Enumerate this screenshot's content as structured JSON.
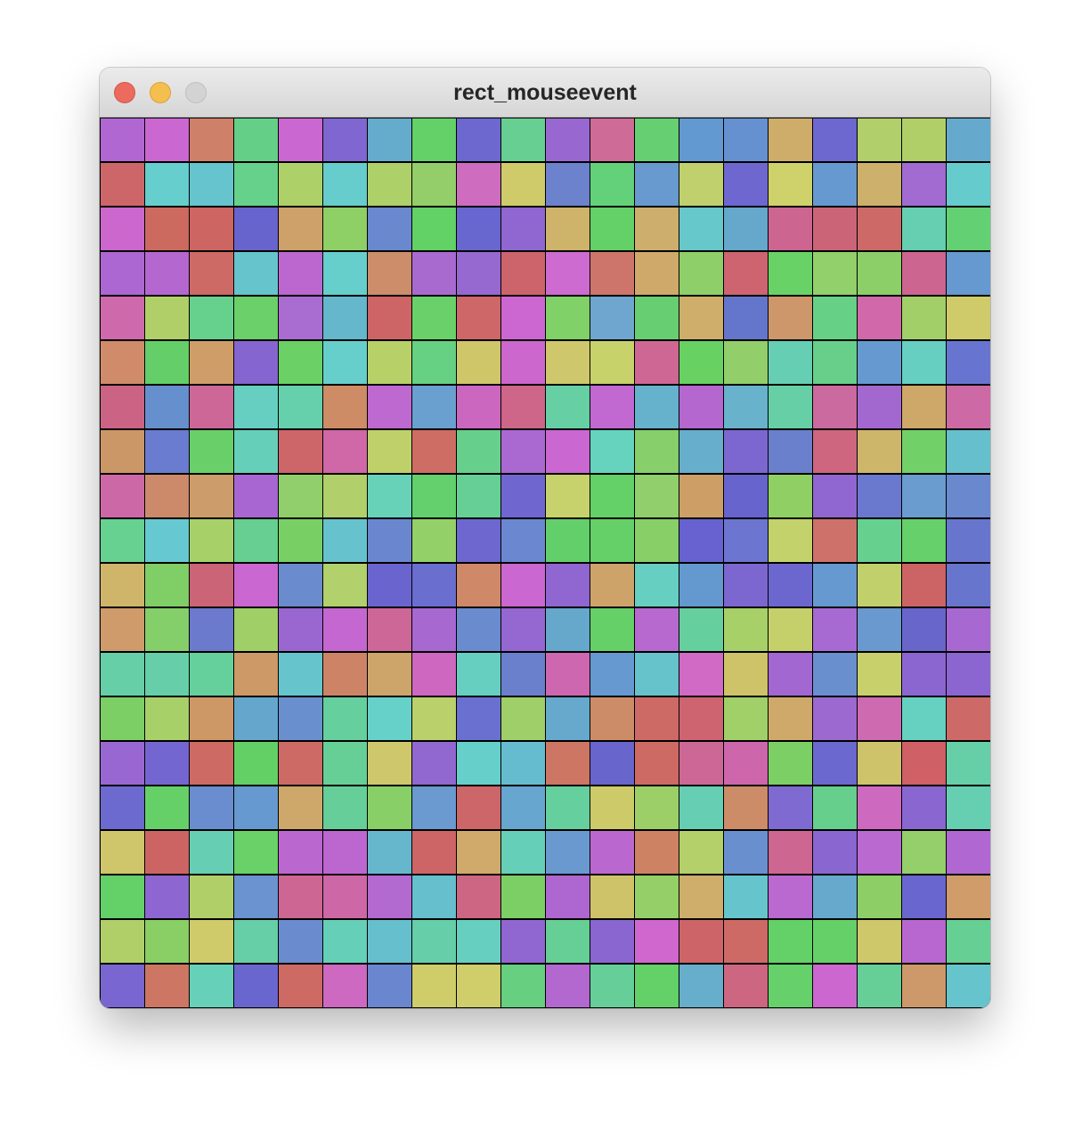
{
  "window": {
    "title": "rect_mouseevent"
  },
  "traffic_lights": {
    "close": {
      "icon": "close-icon",
      "color": "#ed6a5e"
    },
    "minimize": {
      "icon": "minimize-icon",
      "color": "#f5bf4f"
    },
    "zoom": {
      "icon": "zoom-icon",
      "color": "#d3d3d3"
    }
  },
  "grid": {
    "rows": 20,
    "cols": 20,
    "border_color": "#000000",
    "colors": [
      [
        "#b067d1",
        "#cb67d1",
        "#cf8068",
        "#64d087",
        "#cb67d1",
        "#8066d0",
        "#64abcc",
        "#64d068",
        "#6d67d0",
        "#67cf91",
        "#9967d0",
        "#ce6b97",
        "#66cf71",
        "#6299d1",
        "#6591d0",
        "#cead6b",
        "#6d67d0",
        "#b1cf6a",
        "#b1cf68",
        "#65a9cc"
      ],
      [
        "#cd6668",
        "#66cecc",
        "#66c4ce",
        "#66d18b",
        "#aed068",
        "#66cccc",
        "#aed068",
        "#94ce6a",
        "#ce6cbf",
        "#cfcb6a",
        "#6d82cd",
        "#63d17a",
        "#6899cf",
        "#c0d06c",
        "#6f67d0",
        "#cfd16a",
        "#6699cf",
        "#cdb06c",
        "#a16bd2",
        "#66cbcc"
      ],
      [
        "#cb67cd",
        "#cd6a5f",
        "#cd6562",
        "#6864cd",
        "#cea06a",
        "#8ecf66",
        "#6988cd",
        "#62d166",
        "#6867cf",
        "#9066d1",
        "#ceb36a",
        "#64d068",
        "#ceae6c",
        "#66c8cb",
        "#66a7cc",
        "#cd6591",
        "#cc6478",
        "#cd6a68",
        "#67cfb1",
        "#63d173"
      ],
      [
        "#ac67d2",
        "#b567d0",
        "#cd6a66",
        "#66c4cc",
        "#bc67d0",
        "#66cfcb",
        "#cd8d6b",
        "#a96ad0",
        "#9669d0",
        "#cd646b",
        "#cd6bd0",
        "#cd756b",
        "#cea96a",
        "#8fcf69",
        "#cd6470",
        "#68d266",
        "#91d06b",
        "#8ccf69",
        "#cd6591",
        "#6699cf"
      ],
      [
        "#ce6aab",
        "#b1cf68",
        "#66d08d",
        "#6bcf6a",
        "#a96cd0",
        "#65b7cc",
        "#cd6466",
        "#6ad16a",
        "#cd6768",
        "#cc67d1",
        "#7fd168",
        "#6fa6cf",
        "#67cf72",
        "#cfae6b",
        "#6476cb",
        "#cd976b",
        "#66d186",
        "#d168a9",
        "#a3cf69",
        "#d0cb6a"
      ],
      [
        "#cf8b6a",
        "#64cf68",
        "#cf9e68",
        "#8565cf",
        "#6bd066",
        "#66cfcc",
        "#b8d068",
        "#66d083",
        "#cfc66a",
        "#cb67cd",
        "#cfc76b",
        "#c7d26b",
        "#cf6795",
        "#67d162",
        "#92ce6a",
        "#66cfb3",
        "#67cf89",
        "#6699cf",
        "#66cfc2",
        "#6875d0"
      ],
      [
        "#cb6384",
        "#6690cd",
        "#cd6797",
        "#66cfc2",
        "#66cfac",
        "#ce8c66",
        "#bd69d0",
        "#6aa0d0",
        "#cc67c0",
        "#cd6688",
        "#66d0a4",
        "#c169d0",
        "#66b1cc",
        "#b467cf",
        "#68b2cc",
        "#66cfa5",
        "#cb6a9e",
        "#a368d0",
        "#cda868",
        "#cd6aa5"
      ],
      [
        "#cc9766",
        "#6a7ccf",
        "#69cf68",
        "#66cfb9",
        "#cd6668",
        "#d067a6",
        "#bfd06b",
        "#cd6d64",
        "#67cf8c",
        "#a969d1",
        "#cb67d1",
        "#66d3bf",
        "#86cf6a",
        "#66aecc",
        "#7c67d0",
        "#6a80cd",
        "#ce6680",
        "#cdb66a",
        "#72d068",
        "#66bfcc"
      ],
      [
        "#cd68a6",
        "#cd8a6a",
        "#cc9c6a",
        "#a766d1",
        "#90cf6b",
        "#b1cf6a",
        "#68d2b8",
        "#63d06d",
        "#66cf95",
        "#6f67cf",
        "#c7d26d",
        "#63d068",
        "#90cf6b",
        "#cd9f67",
        "#6764cd",
        "#8fcf64",
        "#9066d0",
        "#6a78cd",
        "#6a9ccf",
        "#6a88cd"
      ],
      [
        "#66d191",
        "#66c9d1",
        "#a8d068",
        "#66cf91",
        "#78cf64",
        "#66c3cd",
        "#6a86cf",
        "#94d068",
        "#6d67cf",
        "#6b87cf",
        "#63cf6a",
        "#66d068",
        "#88cf68",
        "#6762cf",
        "#6c75cf",
        "#c4d26b",
        "#cd716a",
        "#66d18f",
        "#66d06a",
        "#6875cd"
      ],
      [
        "#cfb56a",
        "#80ce66",
        "#cc6478",
        "#cb67d1",
        "#6a8ccf",
        "#b2d06b",
        "#6a64cf",
        "#6a6fcf",
        "#cf8868",
        "#cb67d1",
        "#9066d0",
        "#cea36a",
        "#66cfc1",
        "#6499cf",
        "#7b67cf",
        "#6b67cf",
        "#6699cf",
        "#c2d06b",
        "#cc6466",
        "#6875cd"
      ],
      [
        "#cf9b6a",
        "#85cf6b",
        "#6b7acd",
        "#a0cf67",
        "#9967cf",
        "#c567d0",
        "#cd6797",
        "#a768d0",
        "#6a8ccf",
        "#9567d0",
        "#66a8cc",
        "#65d067",
        "#b769d0",
        "#66cf9e",
        "#a7d068",
        "#c6d06b",
        "#a66ad2",
        "#6a99cf",
        "#6966cb",
        "#a868d1"
      ],
      [
        "#66cfa8",
        "#66cfa9",
        "#66d09d",
        "#cd9967",
        "#66c4cd",
        "#cd8466",
        "#cda56a",
        "#cd67bf",
        "#66cfc0",
        "#6a80cd",
        "#cd67b0",
        "#6699cf",
        "#66c3cc",
        "#d06ac4",
        "#cfc36a",
        "#a267d0",
        "#6a8fcf",
        "#c8d06b",
        "#8c66d0",
        "#8c66d0"
      ],
      [
        "#7bcf64",
        "#a7d068",
        "#cd9766",
        "#65a7cc",
        "#6a8fcf",
        "#66cf9e",
        "#66d1c8",
        "#bad06b",
        "#6a70cf",
        "#9fcf68",
        "#66a9cc",
        "#cd8c68",
        "#cd6a66",
        "#cd6470",
        "#a1cf68",
        "#cea96a",
        "#9b69d0",
        "#ce6aaf",
        "#66d1c1",
        "#cd6a68"
      ],
      [
        "#9967d1",
        "#7466d0",
        "#cd6a63",
        "#63d066",
        "#cd6a65",
        "#66cf96",
        "#cfc76b",
        "#9167d0",
        "#66cfca",
        "#66bccf",
        "#cd7663",
        "#6865cd",
        "#cd6a64",
        "#cd6796",
        "#cd66ab",
        "#7ccf64",
        "#6b68cf",
        "#cec36a",
        "#cf6066",
        "#66cfa8"
      ],
      [
        "#6c6acf",
        "#66d068",
        "#6a8dcf",
        "#6699cf",
        "#cea86a",
        "#66cf99",
        "#88cf68",
        "#6a9acf",
        "#cd6668",
        "#66a6cf",
        "#66cf9e",
        "#cdca6a",
        "#9ccf68",
        "#66cfb3",
        "#cd8c68",
        "#7e6ad0",
        "#66cf8c",
        "#cd6ac0",
        "#8966d0",
        "#66cfb1"
      ],
      [
        "#cfc56a",
        "#cd6464",
        "#66cfb3",
        "#6ad068",
        "#bb67d0",
        "#bc67d0",
        "#66b6cc",
        "#cd6466",
        "#cfaa6a",
        "#66cfb8",
        "#6a99cf",
        "#bb67d0",
        "#cd8264",
        "#b3d06a",
        "#6a8fcf",
        "#cd6691",
        "#8966d0",
        "#b969d0",
        "#94cf6b",
        "#b067d1"
      ],
      [
        "#63d068",
        "#8d66d1",
        "#b1cf68",
        "#6a93cf",
        "#cd6693",
        "#cd67a6",
        "#b269d0",
        "#66bfcc",
        "#cd6683",
        "#7ccf64",
        "#ae67d0",
        "#cfc36a",
        "#94cf68",
        "#cfad6a",
        "#66c5cc",
        "#b969d0",
        "#66a9cc",
        "#8dcf66",
        "#6a66cf",
        "#cf9c6a"
      ],
      [
        "#b1cf68",
        "#8acf66",
        "#cfcb6a",
        "#66cfa8",
        "#6a8ccf",
        "#66cfb8",
        "#66bfcc",
        "#66cfa9",
        "#66cfbf",
        "#9066d0",
        "#66cf95",
        "#8a66d0",
        "#d067cf",
        "#cd6468",
        "#cd6a66",
        "#63d068",
        "#66d068",
        "#cfc86a",
        "#b867d0",
        "#66cf93"
      ],
      [
        "#7966d0",
        "#cd7664",
        "#66d1b8",
        "#6a66cf",
        "#cd6a64",
        "#cd69c0",
        "#6a86cf",
        "#cfcd6a",
        "#cfce6a",
        "#66cf80",
        "#b368d0",
        "#66cf99",
        "#63d068",
        "#66aecb",
        "#cd6681",
        "#66d06a",
        "#cd67d0",
        "#66cf98",
        "#cd996a",
        "#66c5cc"
      ]
    ]
  }
}
